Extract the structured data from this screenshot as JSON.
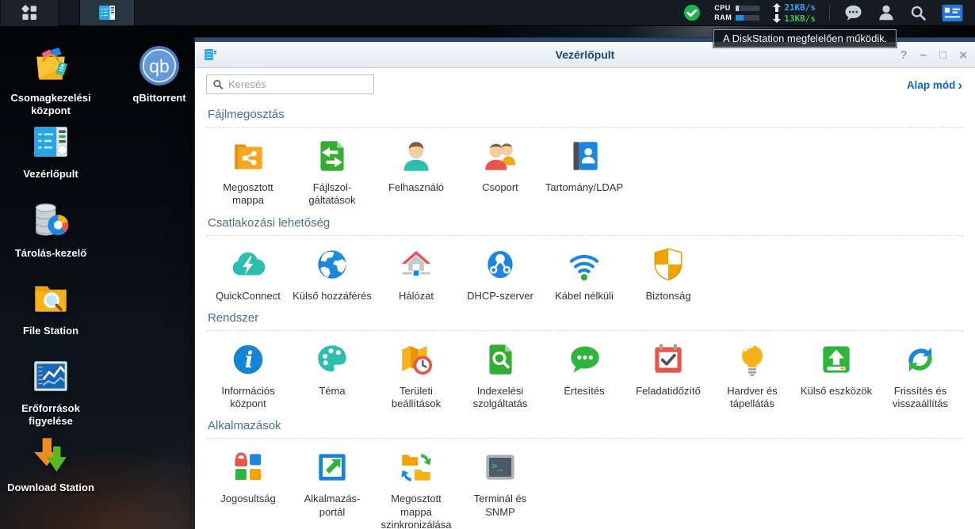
{
  "topbar": {
    "health_tooltip": "A DiskStation megfelelően működik.",
    "cpu_label": "CPU",
    "ram_label": "RAM",
    "cpu_meter_percent": 14,
    "ram_meter_percent": 32,
    "upload_speed": "21KB/s",
    "download_speed": "13KB/s"
  },
  "desktop": {
    "icons": [
      {
        "label": "Csomagkezelési központ"
      },
      {
        "label": "qBittorrent"
      },
      {
        "label": "Vezérlőpult"
      },
      {
        "label": "Tárolás-kezelő"
      },
      {
        "label": "File Station"
      },
      {
        "label": "Erőforrások figyelése"
      },
      {
        "label": "Download Station"
      }
    ]
  },
  "icon_glyphs": {
    "qbittorrent_badge": "qb",
    "info_glyph": "i",
    "terminal_glyph": ">_"
  },
  "window": {
    "title": "Vezérlőpult",
    "search_placeholder": "Keresés",
    "mode_link": "Alap mód",
    "mode_chevron": "›",
    "controls": {
      "help": "?",
      "minimize": "–",
      "maximize": "□",
      "close": "×"
    },
    "sections": [
      {
        "title": "Fájlmegosztás",
        "items": [
          {
            "label": "Megosztott mappa",
            "icon": "shared-folder"
          },
          {
            "label": "Fájlszol- gáltatások",
            "icon": "file-services"
          },
          {
            "label": "Felhasználó",
            "icon": "user"
          },
          {
            "label": "Csoport",
            "icon": "group"
          },
          {
            "label": "Tartomány/LDAP",
            "icon": "domain-ldap"
          }
        ]
      },
      {
        "title": "Csatlakozási lehetőség",
        "items": [
          {
            "label": "QuickConnect",
            "icon": "quickconnect"
          },
          {
            "label": "Külső hozzáférés",
            "icon": "external-access"
          },
          {
            "label": "Hálózat",
            "icon": "network"
          },
          {
            "label": "DHCP-szerver",
            "icon": "dhcp-server"
          },
          {
            "label": "Kábel nélküli",
            "icon": "wireless"
          },
          {
            "label": "Biztonság",
            "icon": "security"
          }
        ]
      },
      {
        "title": "Rendszer",
        "items": [
          {
            "label": "Információs központ",
            "icon": "info-center"
          },
          {
            "label": "Téma",
            "icon": "theme"
          },
          {
            "label": "Területi beállítások",
            "icon": "regional-options"
          },
          {
            "label": "Indexelési szolgáltatás",
            "icon": "indexing-service"
          },
          {
            "label": "Értesítés",
            "icon": "notification"
          },
          {
            "label": "Feladatidőzítő",
            "icon": "task-scheduler"
          },
          {
            "label": "Hardver és tápellátás",
            "icon": "hardware-power"
          },
          {
            "label": "Külső eszközök",
            "icon": "external-devices"
          },
          {
            "label": "Frissítés és visszaállítás",
            "icon": "update-restore"
          }
        ]
      },
      {
        "title": "Alkalmazások",
        "items": [
          {
            "label": "Jogosultság",
            "icon": "privileges"
          },
          {
            "label": "Alkalmazás- portál",
            "icon": "application-portal"
          },
          {
            "label": "Megosztott mappa szinkronizálása",
            "icon": "shared-folder-sync"
          },
          {
            "label": "Terminál és SNMP",
            "icon": "terminal-snmp"
          }
        ]
      }
    ]
  },
  "colors": {
    "accent_blue": "#1b87e0",
    "link_blue": "#0c66c8",
    "title_navy": "#17497e",
    "section_header_blue": "#4a6e94",
    "upload_blue": "#3aa0ff",
    "download_green": "#46be5a",
    "health_green": "#23b24b",
    "topbar_bg": "#151b23"
  }
}
